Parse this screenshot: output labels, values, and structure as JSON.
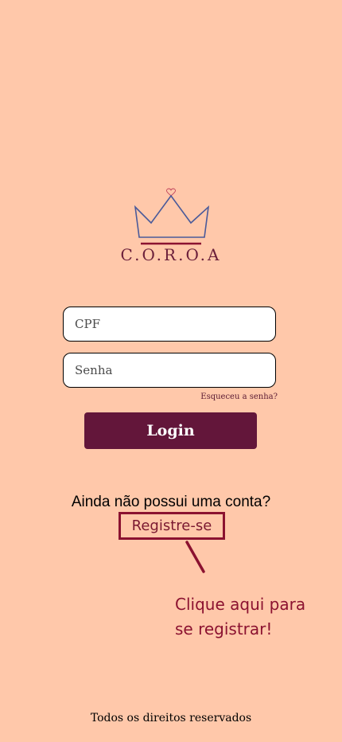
{
  "brand": {
    "name": "C.O.R.O.A",
    "logo_icon": "crown-icon",
    "primary_color": "#63163A",
    "accent_color": "#8B1230",
    "crown_color": "#4A5A9A",
    "background_color": "#FFC8AA"
  },
  "form": {
    "cpf": {
      "placeholder": "CPF",
      "value": ""
    },
    "password": {
      "placeholder": "Senha",
      "value": ""
    },
    "forgot_password": "Esqueceu a senha?",
    "login_button": "Login"
  },
  "signup": {
    "prompt": "Ainda não possui uma conta?",
    "register_link": "Registre-se",
    "hint_line1": "Clique aqui para",
    "hint_line2": "se registrar!"
  },
  "footer": {
    "text": "Todos os direitos reservados"
  }
}
